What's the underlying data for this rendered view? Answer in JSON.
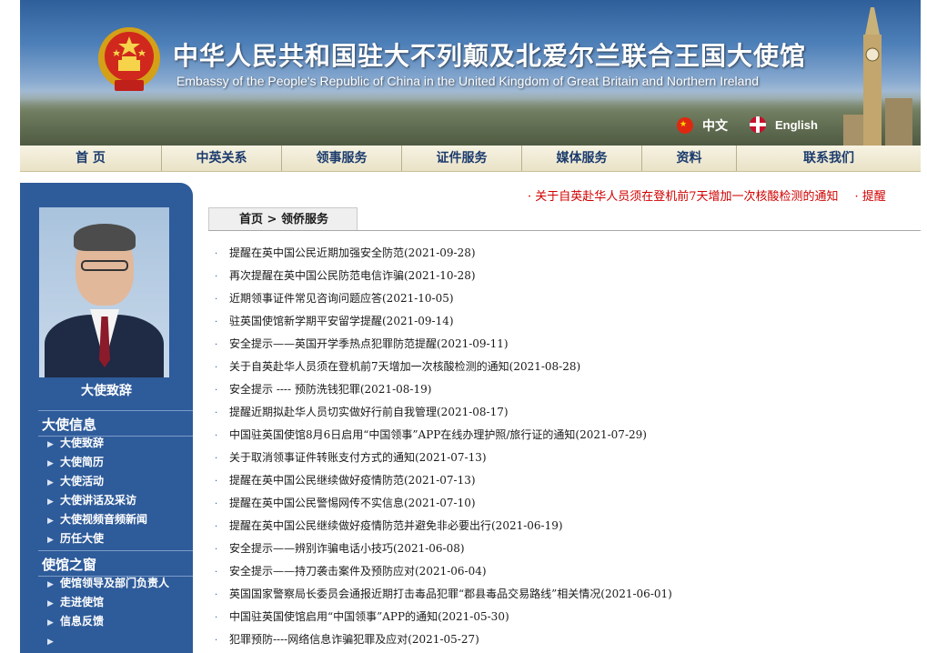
{
  "header": {
    "title_cn": "中华人民共和国驻大不列颠及北爱尔兰联合王国大使馆",
    "title_en": "Embassy of the People's Republic of China in the United Kingdom of Great Britain and Northern Ireland",
    "lang_cn": "中文",
    "lang_en": "English"
  },
  "nav": [
    {
      "label": "首  页"
    },
    {
      "label": "中英关系"
    },
    {
      "label": "领事服务"
    },
    {
      "label": "证件服务"
    },
    {
      "label": "媒体服务"
    },
    {
      "label": "资料"
    },
    {
      "label": "联系我们"
    }
  ],
  "ticker": {
    "items": [
      "· 关于自英赴华人员须在登机前7天增加一次核酸检测的通知",
      "· 提醒"
    ]
  },
  "sidebar": {
    "photo_caption": "大使致辞",
    "section1": {
      "heading": "大使信息",
      "items": [
        "大使致辞",
        "大使简历",
        "大使活动",
        "大使讲话及采访",
        "大使视频音频新闻",
        "历任大使"
      ]
    },
    "section2": {
      "heading": "使馆之窗",
      "items": [
        "使馆领导及部门负责人",
        "走进使馆",
        "信息反馈",
        ""
      ]
    }
  },
  "breadcrumb": {
    "home": "首页",
    "separator": " > ",
    "current": "领侨服务"
  },
  "news": [
    "提醒在英中国公民近期加强安全防范(2021-09-28)",
    "再次提醒在英中国公民防范电信诈骗(2021-10-28)",
    "近期领事证件常见咨询问题应答(2021-10-05)",
    "驻英国使馆新学期平安留学提醒(2021-09-14)",
    "安全提示——英国开学季热点犯罪防范提醒(2021-09-11)",
    "关于自英赴华人员须在登机前7天增加一次核酸检测的通知(2021-08-28)",
    "安全提示 ---- 预防洗钱犯罪(2021-08-19)",
    "提醒近期拟赴华人员切实做好行前自我管理(2021-08-17)",
    "中国驻英国使馆8月6日启用“中国领事”APP在线办理护照/旅行证的通知(2021-07-29)",
    "关于取消领事证件转账支付方式的通知(2021-07-13)",
    "提醒在英中国公民继续做好疫情防范(2021-07-13)",
    "提醒在英中国公民警惕网传不实信息(2021-07-10)",
    "提醒在英中国公民继续做好疫情防范并避免非必要出行(2021-06-19)",
    "安全提示——辨别诈骗电话小技巧(2021-06-08)",
    "安全提示——持刀袭击案件及预防应对(2021-06-04)",
    "英国国家警察局长委员会通报近期打击毒品犯罪“郡县毒品交易路线”相关情况(2021-06-01)",
    "中国驻英国使馆启用“中国领事”APP的通知(2021-05-30)",
    "犯罪预防----网络信息诈骗犯罪及应对(2021-05-27)"
  ],
  "colors": {
    "sidebar_bg": "#2e5b9a",
    "nav_bg": "#f0ead3",
    "ticker": "#d10000",
    "nav_text": "#1b3b6d"
  }
}
